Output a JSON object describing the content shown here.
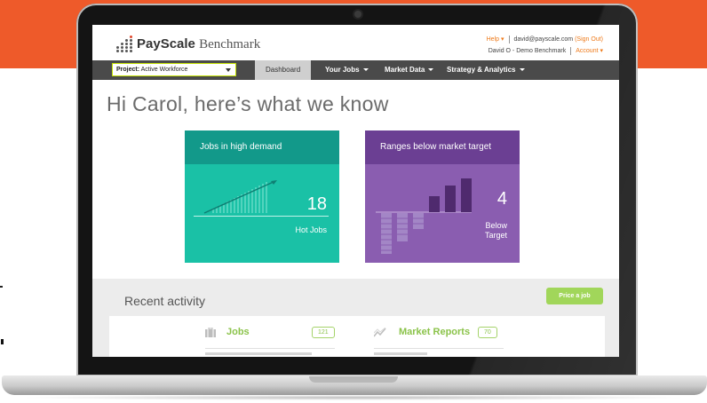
{
  "app": {
    "brand_bold": "PayScale",
    "brand_light": "Benchmark"
  },
  "user_bar": {
    "help_label": "Help",
    "email": "david@payscale.com",
    "sign_out_label": "(Sign Out)",
    "account_name": "David O - Demo Benchmark",
    "account_label": "Account"
  },
  "nav": {
    "project_label": "Project:",
    "project_value": "Active Workforce",
    "items": [
      {
        "label": "Dashboard",
        "active": true
      },
      {
        "label": "Your Jobs",
        "active": false
      },
      {
        "label": "Market Data",
        "active": false
      },
      {
        "label": "Strategy & Analytics",
        "active": false
      }
    ]
  },
  "greeting": "Hi Carol, here’s what we know",
  "cards": {
    "high_demand": {
      "title": "Jobs in high demand",
      "value": "18",
      "label": "Hot Jobs",
      "color": "#1ac1a6",
      "header_color": "#12998a"
    },
    "below_target": {
      "title": "Ranges below market target",
      "value": "4",
      "label_line1": "Below",
      "label_line2": "Target",
      "color": "#8a5db0",
      "header_color": "#6b3f93"
    }
  },
  "recent_activity": {
    "title": "Recent activity",
    "price_button": "Price a job",
    "sections": [
      {
        "label": "Jobs",
        "count": "121",
        "icon": "briefcase-icon"
      },
      {
        "label": "Market Reports",
        "count": "70",
        "icon": "trend-chart-icon"
      }
    ]
  },
  "colors": {
    "page_band": "#ee5a2a",
    "accent_green": "#8bc34a",
    "nav_bg": "#4a4a4a"
  }
}
